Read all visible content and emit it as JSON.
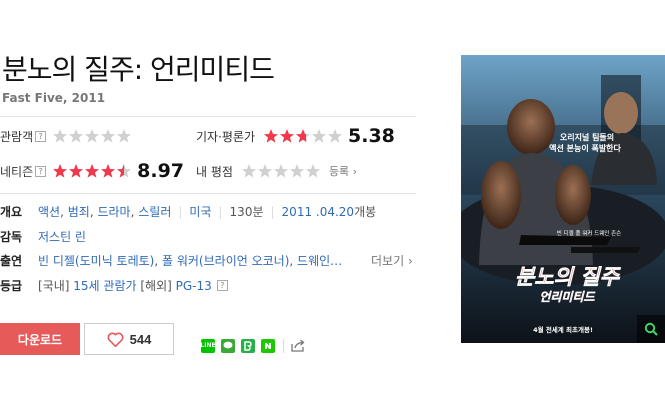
{
  "movie": {
    "title": "분노의 질주: 언리미티드",
    "subtitle": "Fast Five, 2011"
  },
  "ratings": {
    "audience": {
      "label": "관람객",
      "help": "?",
      "stars": 0
    },
    "critics": {
      "label": "기자·평론가",
      "stars": 2.7,
      "score": "5.38"
    },
    "netizen": {
      "label": "네티즌",
      "help": "?",
      "stars": 4.5,
      "score": "8.97"
    },
    "mine": {
      "label": "내 평점",
      "stars": 0,
      "link": "등록"
    }
  },
  "info": {
    "overview_label": "개요",
    "genres": [
      "액션",
      "범죄",
      "드라마",
      "스릴러"
    ],
    "country": "미국",
    "runtime": "130분",
    "release_date": "2011 .04.20",
    "release_suffix": "개봉",
    "director_label": "감독",
    "director": "저스틴 린",
    "cast_label": "출연",
    "cast": [
      "빈 디젤(도미닉 토레토)",
      "폴 워커(브라이언 오코너)",
      "드웨인…"
    ],
    "more": "더보기",
    "grade_label": "등급",
    "grade_kr_prefix": "[국내]",
    "grade_kr": "15세 관람가",
    "grade_os_prefix": "[해외]",
    "grade_os": "PG-13",
    "grade_help": "?"
  },
  "actions": {
    "download": "다운로드",
    "likes": "544"
  },
  "share": {
    "icons": [
      "line-icon",
      "kakaotalk-icon",
      "band-icon",
      "naver-icon"
    ],
    "colors": {
      "line": "#00c300",
      "kakao": "#f7e317",
      "band": "#2ab04a",
      "naver": "#1ec800"
    }
  },
  "poster": {
    "tagline_1": "오리지널 팀들의",
    "tagline_2": "액션 본능이 폭발한다",
    "names": "빈 디젤   폴 워커   드웨인 존슨",
    "logo_1": "분노의 질주",
    "logo_2": "언리미티드",
    "release_text": "4월 전세계 최초개봉!"
  },
  "colors": {
    "star_on": "#f0394a",
    "star_off": "#d0d0d0",
    "download_bg": "#e65a5a",
    "link": "#2e6ab9"
  }
}
